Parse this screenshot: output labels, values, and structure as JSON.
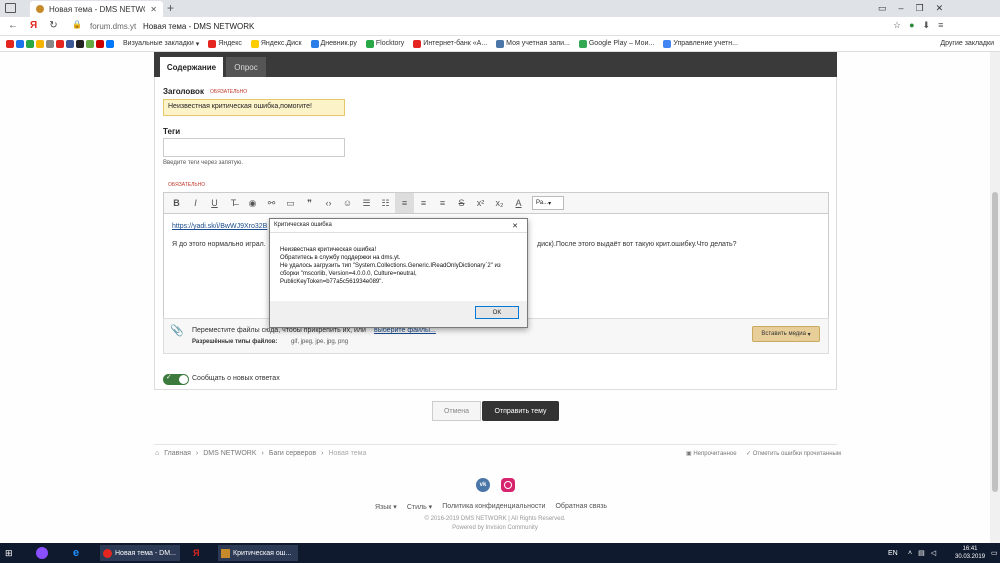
{
  "browser": {
    "tab_title": "Новая тема - DMS NETWORK",
    "url": "forum.dms.yt",
    "page_title": "Новая тема - DMS NETWORK"
  },
  "bookmarks": {
    "items": [
      "Визуальные закладки",
      "Яндекс",
      "Яндекс.Диск",
      "Дневник.ру",
      "Flocktory",
      "Интернет-банк «А...",
      "Моя учетная запи...",
      "Google Play – Мои...",
      "Управление учетн..."
    ],
    "other": "Другие закладки"
  },
  "form": {
    "tabs": [
      "Содержание",
      "Опрос"
    ],
    "title_label": "Заголовок",
    "required": "ОБЯЗАТЕЛЬНО",
    "title_value": "Неизвестная критическая ошибка,помогите!",
    "tags_label": "Теги",
    "tags_hint": "Введите теги через запятую.",
    "required2": "ОБЯЗАТЕЛЬНО",
    "style_select": "Ра...",
    "link_text": "https://yadi.sk/i/BwWJ9Xro32B",
    "body_left": "Я до этого нормально играл.",
    "body_right": "диск).После этого выдаёт вот такую крит.ошибку.Что делать?",
    "attach_text": "Переместите файлы сюда, чтобы прикрепить их, или",
    "attach_link": "выберите файлы...",
    "attach_types_label": "Разрешённые типы файлов:",
    "attach_types": "gif, jpeg, jpe, jpg, png",
    "insert_media": "Вставить медиа",
    "watch_label": "Следить за темой",
    "notify_label": "Сообщать о новых ответах",
    "cancel": "Отмена",
    "submit": "Отправить тему"
  },
  "breadcrumb": {
    "items": [
      "Главная",
      "DMS NETWORK",
      "Баги серверов",
      "Новая тема"
    ],
    "unread": "Непрочитанное",
    "mark_read": "Отметить ошибки прочитанным"
  },
  "footer": {
    "language": "Язык",
    "style": "Стиль",
    "privacy": "Политика конфиденциальности",
    "feedback": "Обратная связь",
    "copyright": "© 2016-2019 DMS NETWORK | All Rights Reserved.",
    "powered": "Powered by Invision Community"
  },
  "dialog": {
    "title": "Критическая ошибка",
    "close": "✕",
    "line1": "Неизвестная критическая ошибка!",
    "line2": "Обратитесь в службу поддержки на dms.yt.",
    "line3": "Не удалось загрузить тип \"System.Collections.Generic.IReadOnlyDictionary`2\" из сборки \"mscorlib, Version=4.0.0.0, Culture=neutral, PublicKeyToken=b77a5c561934e089\".",
    "ok": "OK"
  },
  "taskbar": {
    "apps": [
      "Новая тема - DM...",
      "Критическая ош..."
    ],
    "lang": "EN",
    "time": "16:41",
    "date": "30.03.2019"
  },
  "colors": {
    "dark_header": "#3a3a3a",
    "title_field": "#fdf3c9",
    "toggle": "#3d7a3d",
    "submit": "#333333",
    "media_btn": "#e8cf9a",
    "dialog_border": "#7a7a7a"
  }
}
